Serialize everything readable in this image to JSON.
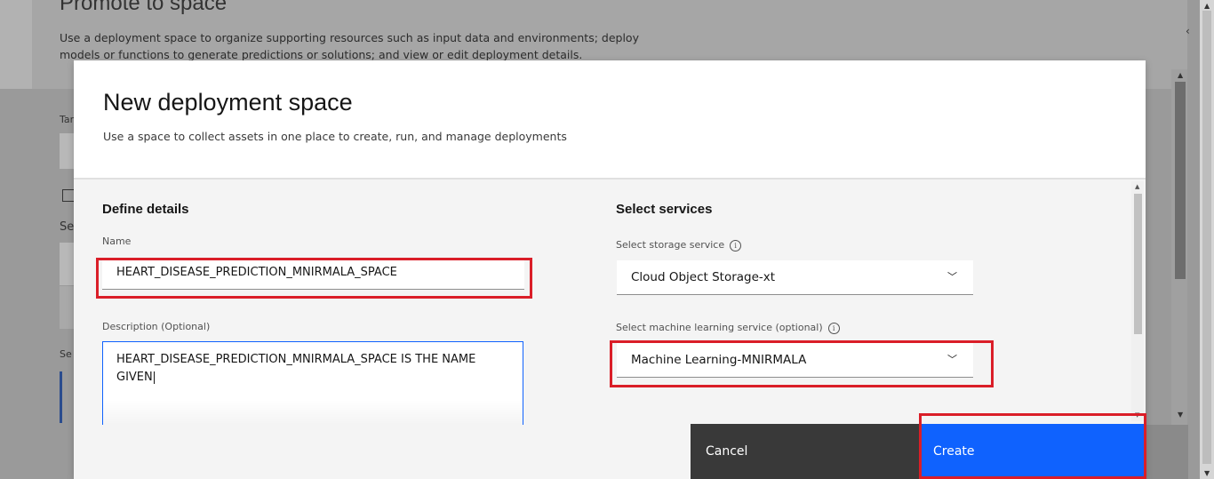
{
  "background": {
    "title": "Promote to space",
    "description": "Use a deployment space to organize supporting resources such as input data and environments; deploy models or functions to generate predictions or solutions; and view or edit deployment details.",
    "side_labels": [
      "Tar",
      "Se",
      "Se"
    ],
    "collapse_icon": "chevron-left-icon"
  },
  "modal": {
    "title": "New deployment space",
    "subtitle": "Use a space to collect assets in one place to create, run, and manage deployments",
    "define_details": {
      "heading": "Define details",
      "name_label": "Name",
      "name_value": "HEART_DISEASE_PREDICTION_MNIRMALA_SPACE",
      "description_label": "Description (Optional)",
      "description_value": "HEART_DISEASE_PREDICTION_MNIRMALA_SPACE IS THE NAME GIVEN"
    },
    "select_services": {
      "heading": "Select services",
      "storage_label": "Select storage service",
      "storage_value": "Cloud Object Storage-xt",
      "ml_label": "Select machine learning service (optional)",
      "ml_value": "Machine Learning-MNIRMALA",
      "info_glyph": "i",
      "chevron_icon": "chevron-down-icon"
    },
    "buttons": {
      "cancel": "Cancel",
      "create": "Create"
    }
  },
  "colors": {
    "primary": "#0f62fe",
    "highlight": "#da1e28",
    "secondary_button": "#393939"
  }
}
